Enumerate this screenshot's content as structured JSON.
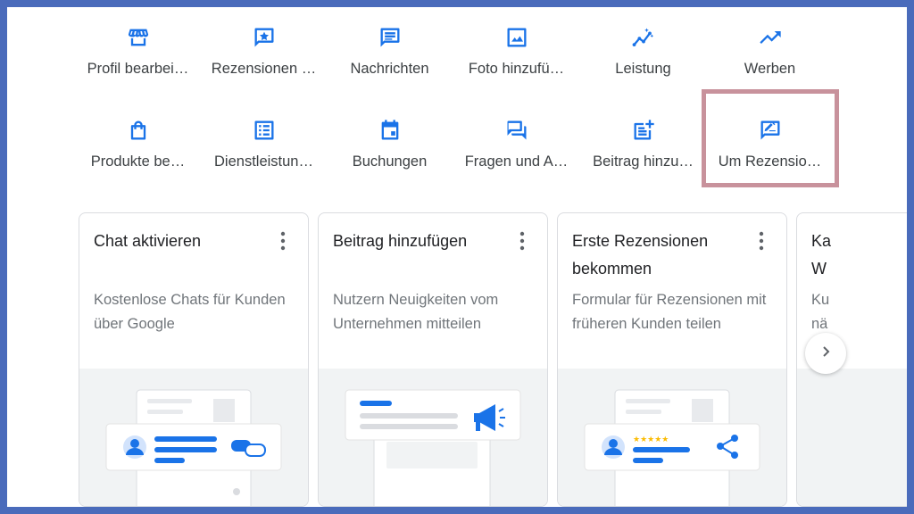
{
  "actions": [
    {
      "label": "Profil bearbei…",
      "icon": "storefront-icon"
    },
    {
      "label": "Rezensionen …",
      "icon": "star-review-icon"
    },
    {
      "label": "Nachrichten",
      "icon": "message-icon"
    },
    {
      "label": "Foto hinzufü…",
      "icon": "photo-icon"
    },
    {
      "label": "Leistung",
      "icon": "insights-icon"
    },
    {
      "label": "Werben",
      "icon": "trending-up-icon"
    },
    {
      "label": "Produkte be…",
      "icon": "shopping-bag-icon"
    },
    {
      "label": "Dienstleistun…",
      "icon": "list-icon"
    },
    {
      "label": "Buchungen",
      "icon": "calendar-icon"
    },
    {
      "label": "Fragen und A…",
      "icon": "forum-icon"
    },
    {
      "label": "Beitrag hinzu…",
      "icon": "post-add-icon"
    },
    {
      "label": "Um Rezensio…",
      "icon": "rate-review-icon"
    }
  ],
  "cards": [
    {
      "title": "Chat aktivieren",
      "desc": "Kostenlose Chats für Kunden über Google"
    },
    {
      "title": "Beitrag hinzufügen",
      "desc": "Nutzern Neuigkeiten vom Unternehmen mitteilen"
    },
    {
      "title": "Erste Rezensionen bekommen",
      "desc": "Formular für Rezensionen mit früheren Kunden teilen"
    },
    {
      "title": "Ka W",
      "desc": "Ku nä"
    }
  ],
  "colors": {
    "accent": "#1a73e8",
    "highlight_border": "#c8929c",
    "frame_border": "#4a6bbb",
    "stars": "#fbbc04"
  }
}
